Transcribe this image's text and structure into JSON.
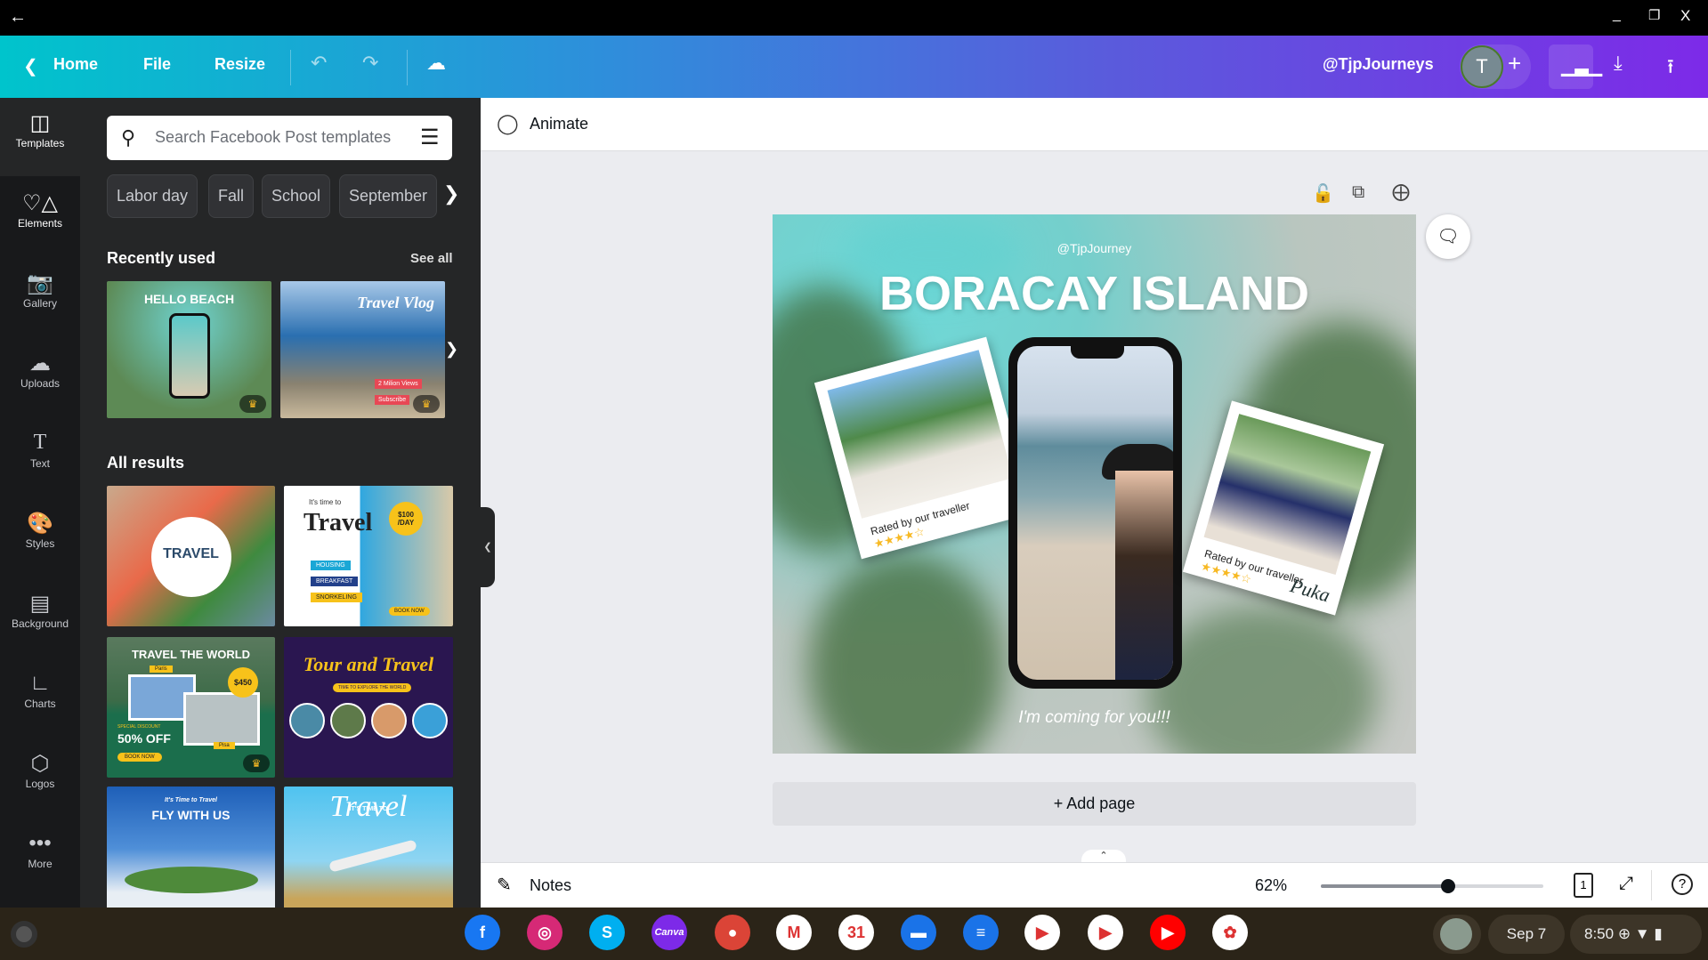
{
  "system": {
    "back_icon": "arrow-left-icon",
    "minimize": "_",
    "restore": "restore-icon",
    "close": "X"
  },
  "header": {
    "home": "Home",
    "file": "File",
    "resize": "Resize",
    "username": "@TjpJourneys",
    "avatar_letter": "T",
    "accent_start": "#00c4cc",
    "accent_end": "#7d2ae8"
  },
  "nav": [
    {
      "label": "Templates",
      "icon": "templates-icon"
    },
    {
      "label": "Elements",
      "icon": "elements-icon"
    },
    {
      "label": "Gallery",
      "icon": "camera-icon"
    },
    {
      "label": "Uploads",
      "icon": "upload-cloud-icon"
    },
    {
      "label": "Text",
      "icon": "text-icon"
    },
    {
      "label": "Styles",
      "icon": "palette-icon"
    },
    {
      "label": "Background",
      "icon": "background-icon"
    },
    {
      "label": "Charts",
      "icon": "chart-icon"
    },
    {
      "label": "Logos",
      "icon": "logo-icon"
    },
    {
      "label": "More",
      "icon": "more-icon"
    }
  ],
  "panel": {
    "search_placeholder": "Search Facebook Post templates",
    "chips": [
      "Labor day",
      "Fall",
      "School",
      "September"
    ],
    "recent_title": "Recently used",
    "see_all": "See all",
    "recent": [
      {
        "title": "HELLO BEACH"
      },
      {
        "title": "Travel Vlog",
        "badge1": "2 Milion Views",
        "badge2": "Subscribe"
      }
    ],
    "all_title": "All results",
    "results": [
      {
        "title": "TRAVEL"
      },
      {
        "title": "Travel",
        "pre": "It's time to",
        "price": "$100 /DAY",
        "items": [
          "HOUSING",
          "BREAKFAST",
          "SNORKELING"
        ],
        "cta": "BOOK NOW"
      },
      {
        "title": "TRAVEL THE WORLD",
        "price": "$450",
        "discount": "50% OFF",
        "label": "SPECIAL DISCOUNT",
        "cta": "BOOK NOW",
        "city1": "Paris",
        "city2": "Pisa"
      },
      {
        "title": "Tour and Travel",
        "sub": "TIME TO EXPLORE THE WORLD"
      },
      {
        "title": "FLY WITH US",
        "pre": "It's Time to Travel"
      },
      {
        "title": "Travel",
        "pre": "IT'S TIME TO"
      }
    ]
  },
  "editor": {
    "animate": "Animate",
    "add_page": "+ Add page"
  },
  "design": {
    "handle": "@TjpJourney",
    "title": "BORACAY ISLAND",
    "caption1": "Rated by our traveller",
    "caption2": "Rated by our traveller",
    "stars1": "★★★★☆",
    "stars2": "★★★★☆",
    "signature": "Puka",
    "tagline": "I'm coming for you!!!"
  },
  "footer": {
    "notes": "Notes",
    "zoom": "62%",
    "zoom_fraction": 0.57,
    "page": "1"
  },
  "taskbar": {
    "apps": [
      {
        "name": "facebook",
        "label": "f",
        "color": "#1877f2"
      },
      {
        "name": "instagram",
        "label": "◎",
        "color": "#d62976"
      },
      {
        "name": "skype",
        "label": "S",
        "color": "#00aff0"
      },
      {
        "name": "canva",
        "label": "Canva",
        "color": "#7d2ae8"
      },
      {
        "name": "chrome",
        "label": "●",
        "color": "#db4437"
      },
      {
        "name": "gmail",
        "label": "M",
        "color": "#ffffff"
      },
      {
        "name": "calendar",
        "label": "31",
        "color": "#ffffff"
      },
      {
        "name": "files",
        "label": "▬",
        "color": "#1a73e8"
      },
      {
        "name": "messages",
        "label": "≡",
        "color": "#1a73e8"
      },
      {
        "name": "meet",
        "label": "▶",
        "color": "#ffffff"
      },
      {
        "name": "play-store",
        "label": "▶",
        "color": "#ffffff"
      },
      {
        "name": "youtube",
        "label": "▶",
        "color": "#ff0000"
      },
      {
        "name": "photos",
        "label": "✿",
        "color": "#ffffff"
      }
    ],
    "date": "Sep 7",
    "time": "8:50"
  }
}
